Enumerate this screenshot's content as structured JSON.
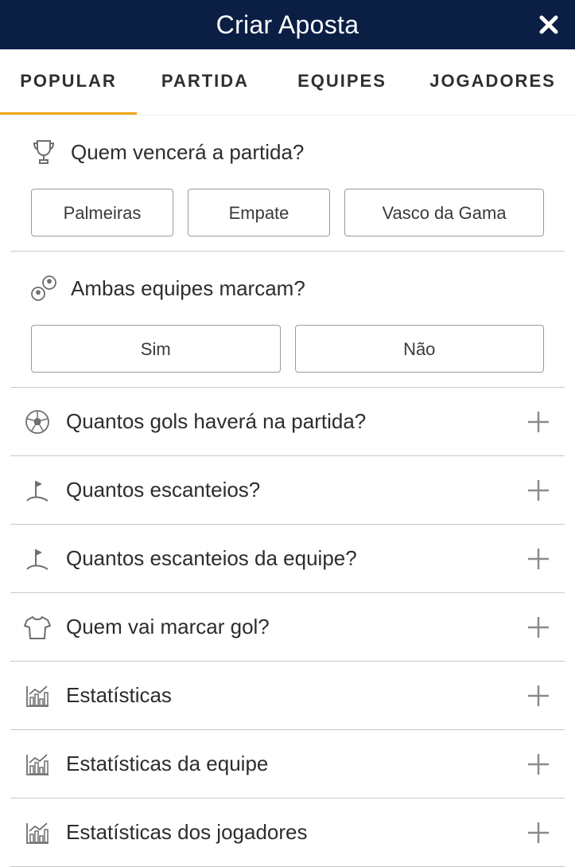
{
  "header": {
    "title": "Criar Aposta",
    "close_icon": "close-icon"
  },
  "tabs": [
    {
      "label": "POPULAR",
      "active": true
    },
    {
      "label": "PARTIDA",
      "active": false
    },
    {
      "label": "EQUIPES",
      "active": false
    },
    {
      "label": "JOGADORES",
      "active": false
    }
  ],
  "accent_color": "#f2a71b",
  "header_color": "#0b1f45",
  "markets": {
    "winner": {
      "title": "Quem vencerá a partida?",
      "icon": "trophy-icon",
      "options": [
        "Palmeiras",
        "Empate",
        "Vasco da Gama"
      ]
    },
    "btts": {
      "title": "Ambas equipes marcam?",
      "icon": "balls-icon",
      "options": [
        "Sim",
        "Não"
      ]
    }
  },
  "collapsed": [
    {
      "label": "Quantos gols haverá na partida?",
      "icon": "football-icon"
    },
    {
      "label": "Quantos escanteios?",
      "icon": "corner-flag-icon"
    },
    {
      "label": "Quantos escanteios da equipe?",
      "icon": "corner-flag-icon"
    },
    {
      "label": "Quem vai marcar gol?",
      "icon": "shirt-icon"
    },
    {
      "label": "Estatísticas",
      "icon": "chart-icon"
    },
    {
      "label": "Estatísticas da equipe",
      "icon": "chart-icon"
    },
    {
      "label": "Estatísticas dos jogadores",
      "icon": "chart-icon"
    }
  ]
}
